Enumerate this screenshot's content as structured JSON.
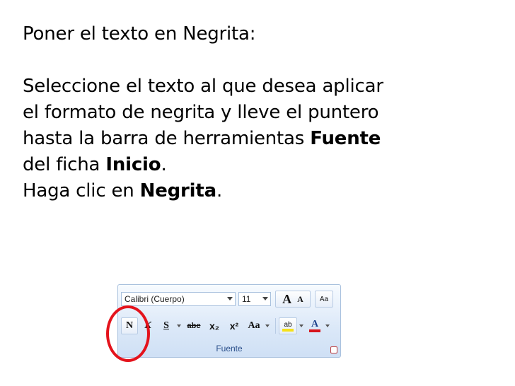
{
  "slide": {
    "title": "Poner el texto en Negrita:",
    "line1": "Seleccione el texto al que desea aplicar",
    "line2": "el formato de negrita y lleve el puntero",
    "line3_pre": "hasta la barra de herramientas ",
    "line3_bold": "Fuente",
    "line4_pre": "del ficha ",
    "line4_bold": "Inicio",
    "line4_post": ".",
    "line5_pre": "Haga clic en ",
    "line5_bold": "Negrita",
    "line5_post": "."
  },
  "ribbon": {
    "font_name": "Calibri (Cuerpo)",
    "font_size": "11",
    "grow_label": "A",
    "shrink_label": "A",
    "clear_label": "Aa",
    "bold_label": "N",
    "italic_label": "K",
    "underline_label": "S",
    "strike_label": "abc",
    "subscript_label": "x₂",
    "superscript_label": "x²",
    "case_label": "Aa",
    "highlight_label": "ab",
    "fontcolor_label": "A",
    "group_label": "Fuente"
  },
  "colors": {
    "highlight": "#f5e11a",
    "font_color": "#d6141c",
    "annotation_circle": "#e4131c"
  }
}
